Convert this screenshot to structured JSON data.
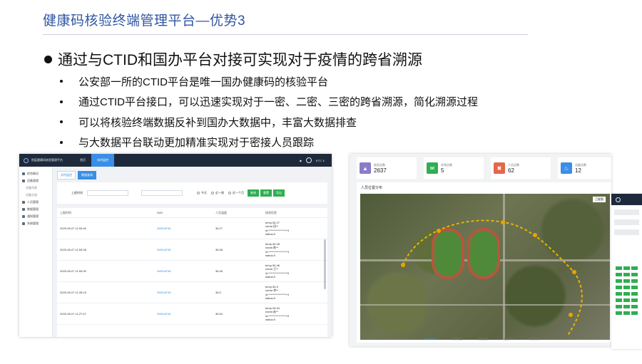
{
  "slide": {
    "title": "健康码核验终端管理平台—优势3",
    "main_bullet": "通过与CTID和国办平台对接可实现对于疫情的跨省溯源",
    "sub_bullets": [
      "公安部一所的CTID平台是唯一国办健康码的核验平台",
      "通过CTID平台接口，可以迅速实现对于一密、二密、三密的跨省溯源，简化溯源过程",
      "可以将核验终端数据反补到国办大数据中，丰富大数据排查",
      "与大数据平台联动更加精准实现对于密接人员跟踪"
    ]
  },
  "left_app": {
    "app_name": "防疫健康码核验管理平台",
    "top_tabs": [
      "首页",
      "实时监控"
    ],
    "user_label": "ETC ∨",
    "bell_icon": "bell-icon",
    "sidebar": [
      {
        "label": "综合概况",
        "icon": "grid-icon",
        "sub": false
      },
      {
        "label": "设备管理",
        "icon": "device-icon",
        "sub": false
      },
      {
        "label": "设备列表",
        "icon": "",
        "sub": true
      },
      {
        "label": "设备分组",
        "icon": "",
        "sub": true
      },
      {
        "label": "人员管理",
        "icon": "user-icon",
        "sub": false
      },
      {
        "label": "数据管理",
        "icon": "data-icon",
        "sub": false
      },
      {
        "label": "通知管理",
        "icon": "bell-icon",
        "sub": false
      },
      {
        "label": "系统管理",
        "icon": "gear-icon",
        "sub": false
      }
    ],
    "sub_tabs": [
      "实时监控",
      "数据查询"
    ],
    "filter": {
      "label": "上报时间",
      "radios": [
        "今天",
        "近一周",
        "近一个月"
      ],
      "buttons": [
        {
          "label": "查询",
          "color": "#2fae52"
        },
        {
          "label": "重置",
          "color": "#2fae52"
        },
        {
          "label": "导出",
          "color": "#2fae52"
        }
      ]
    },
    "table": {
      "headers": [
        "上报时间",
        "IMEI",
        "人员温度",
        "核验信息"
      ],
      "rows": [
        {
          "time": "2020-06-07 11:53:46",
          "imei": "I3591AF36",
          "temp": "36.27",
          "info": [
            "temp:36.27",
            "name:田**",
            "id:*****************3",
            "status:0"
          ]
        },
        {
          "time": "2020-06-07 11:53:38",
          "imei": "I3591AF36",
          "temp": "36.08",
          "info": [
            "temp:36.08",
            "name:陈**",
            "id:*****************3",
            "status:0"
          ]
        },
        {
          "time": "2020-06-07 11:53:30",
          "imei": "I3591AF36",
          "temp": "36.46",
          "info": [
            "temp:36.46",
            "name:王**",
            "id:*****************5",
            "status:0"
          ]
        },
        {
          "time": "2020-06-07 11:28:15",
          "imei": "I3591AF36",
          "temp": "36.5",
          "info": [
            "temp:36.5",
            "name:李**",
            "id:*****************4",
            "status:0"
          ]
        },
        {
          "time": "2020-06-07 11:27:47",
          "imei": "I3591AF36",
          "temp": "36.54",
          "info": [
            "temp:36.54",
            "name:赵**",
            "id:*****************8",
            "status:0"
          ]
        }
      ]
    }
  },
  "right_app": {
    "stats": [
      {
        "label": "核验总数",
        "value": "2637",
        "color": "#8b7bc8",
        "icon": "chart-icon"
      },
      {
        "label": "异常总数",
        "value": "5",
        "color": "#2fae52",
        "icon": "mail-icon"
      },
      {
        "label": "人员总数",
        "value": "62",
        "color": "#e4674a",
        "icon": "cross-icon"
      },
      {
        "label": "设备总数",
        "value": "12",
        "color": "#3a8ee6",
        "icon": "bell-icon"
      }
    ],
    "map_title": "人员位置分布",
    "map_zoom_label": "卫星图",
    "map_footer": [
      "2020-06-15 10:21:32",
      "I3591AF36",
      "核验轨迹",
      "设备位置",
      "温度异常",
      "核验失败"
    ]
  }
}
